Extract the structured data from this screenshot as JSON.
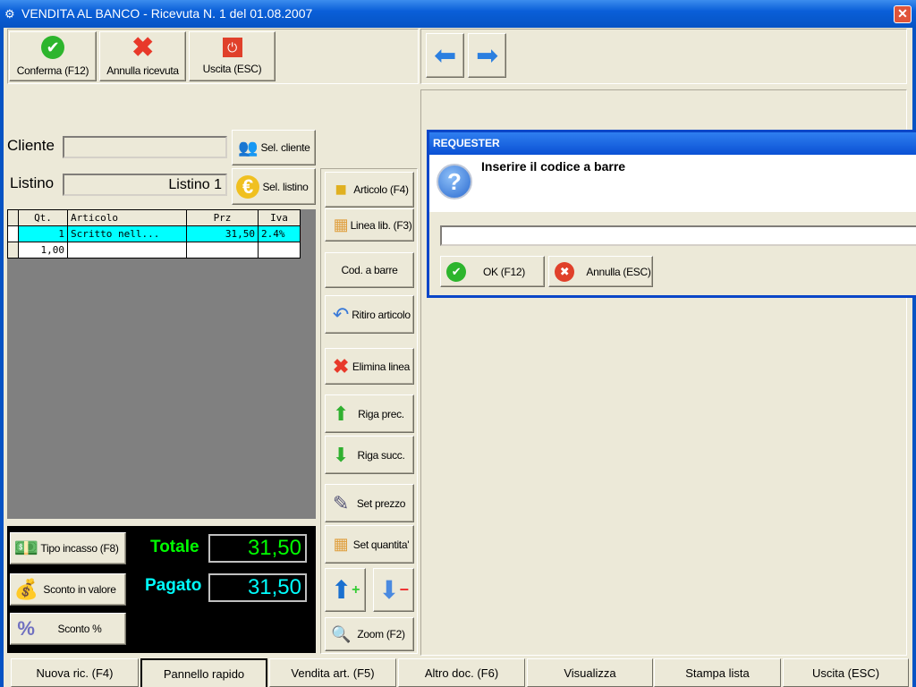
{
  "window": {
    "title": "VENDITA AL BANCO - Ricevuta N. 1 del 01.08.2007",
    "close_icon": "close-icon"
  },
  "toolbar": {
    "confirm": "Conferma (F12)",
    "cancel": "Annulla ricevuta",
    "exit": "Uscita (ESC)"
  },
  "customer": {
    "label": "Cliente",
    "value": "",
    "select": "Sel. cliente"
  },
  "pricelist": {
    "label": "Listino",
    "value": "Listino 1",
    "select": "Sel. listino"
  },
  "grid": {
    "columns": [
      "Qt.",
      "Articolo",
      "Prz",
      "Iva"
    ],
    "rows": [
      [
        "1",
        "Scritto nell...",
        "31,50",
        "2.4%"
      ],
      [
        "1,00",
        "",
        "",
        ""
      ]
    ],
    "selected_color": "#00ffff"
  },
  "actions": {
    "articolo": "Articolo (F4)",
    "linea": "Linea lib. (F3)",
    "codbarre": "Cod. a barre",
    "ritiro": "Ritiro articolo",
    "elimina": "Elimina linea",
    "prec": "Riga prec.",
    "succ": "Riga succ.",
    "prezzo": "Set prezzo",
    "quantita": "Set quantita'",
    "zoom": "Zoom (F2)"
  },
  "payment": {
    "tipo": "Tipo incasso (F8)",
    "sconto_valore": "Sconto in valore",
    "sconto_perc": "Sconto %",
    "totale_label": "Totale",
    "totale": "31,50",
    "pagato_label": "Pagato",
    "pagato": "31,50",
    "totale_color": "#00ff00",
    "pagato_color": "#00ffff"
  },
  "dialog": {
    "title": "REQUESTER",
    "message": "Inserire il codice a barre",
    "input": "",
    "ok": "OK (F12)",
    "cancel": "Annulla (ESC)"
  },
  "tabs": [
    {
      "label": "Nuova ric. (F4)"
    },
    {
      "label": "Pannello rapido",
      "selected": true
    },
    {
      "label": "Vendita art. (F5)"
    },
    {
      "label": "Altro doc. (F6)"
    },
    {
      "label": "Visualizza"
    },
    {
      "label": "Stampa lista"
    },
    {
      "label": "Uscita (ESC)"
    }
  ]
}
